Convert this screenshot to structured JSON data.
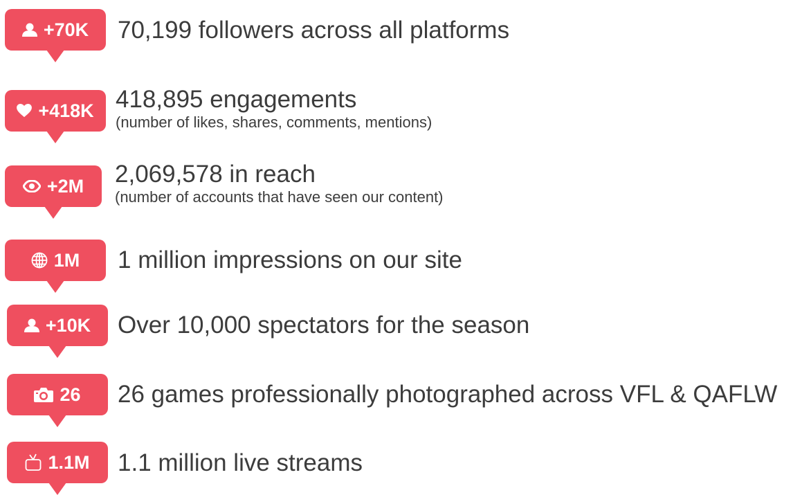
{
  "colors": {
    "badge": "#ef4f5f",
    "text": "#3c3c3c"
  },
  "stats": [
    {
      "icon": "user-icon",
      "badge": "+70K",
      "text": "70,199 followers across all platforms",
      "sub": ""
    },
    {
      "icon": "heart-icon",
      "badge": "+418K",
      "text": "418,895 engagements",
      "sub": "(number of likes, shares, comments, mentions)"
    },
    {
      "icon": "eye-icon",
      "badge": "+2M",
      "text": "2,069,578 in reach",
      "sub": "(number of accounts that have seen our content)"
    },
    {
      "icon": "globe-icon",
      "badge": "1M",
      "text": "1 million impressions on our site",
      "sub": ""
    },
    {
      "icon": "user-icon",
      "badge": "+10K",
      "text": "Over 10,000 spectators for the season",
      "sub": ""
    },
    {
      "icon": "camera-icon",
      "badge": "26",
      "text": "26 games professionally photographed across VFL & QAFLW",
      "sub": ""
    },
    {
      "icon": "tv-icon",
      "badge": "1.1M",
      "text": "1.1 million live streams",
      "sub": ""
    }
  ]
}
